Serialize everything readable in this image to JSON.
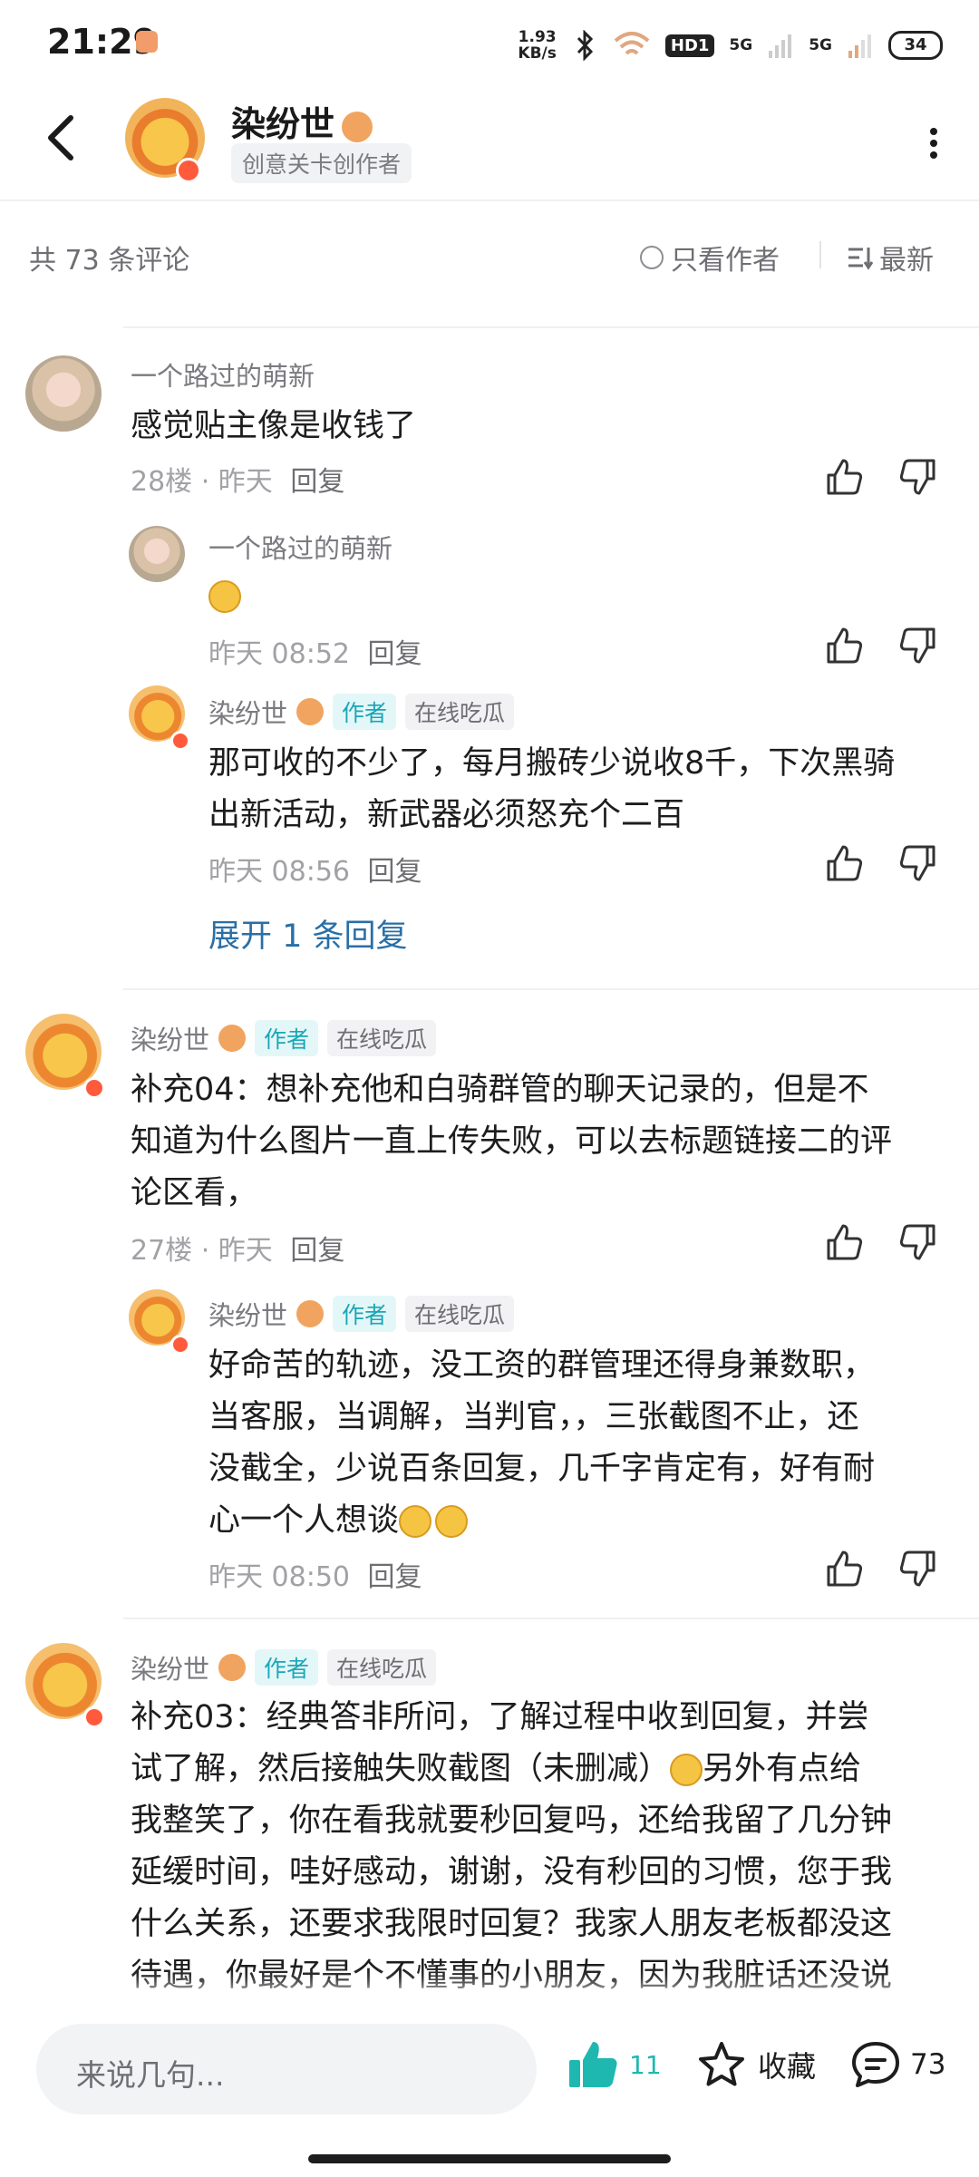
{
  "status_bar": {
    "time": "21:29",
    "net_speed_value": "1.93",
    "net_speed_unit": "KB/s",
    "hd_label": "HD1",
    "signal_1": "5G",
    "signal_2": "5G",
    "battery": "34"
  },
  "header": {
    "author_name": "染纷世",
    "author_tag": "创意关卡创作者"
  },
  "comment_bar": {
    "count_text": "共 73 条评论",
    "only_author_label": "只看作者",
    "sort_label": "最新"
  },
  "comments": [
    {
      "user": "一个路过的萌新",
      "text": "感觉贴主像是收钱了",
      "floor": "28楼",
      "time": "昨天",
      "reply_label": "回复",
      "replies": [
        {
          "user": "一个路过的萌新",
          "time": "昨天 08:52",
          "reply_label": "回复"
        },
        {
          "user": "染纷世",
          "author_tag": "作者",
          "status_tag": "在线吃瓜",
          "text_l1": "那可收的不少了，每月搬砖少说收8千，下次黑骑",
          "text_l2": "出新活动，新武器必须怒充个二百",
          "time": "昨天 08:56",
          "reply_label": "回复"
        }
      ],
      "expand_label": "展开 1 条回复"
    },
    {
      "user": "染纷世",
      "author_tag": "作者",
      "status_tag": "在线吃瓜",
      "text_l1": "补充04：想补充他和白骑群管的聊天记录的，但是不",
      "text_l2": "知道为什么图片一直上传失败，可以去标题链接二的评",
      "text_l3": "论区看，",
      "floor": "27楼",
      "time": "昨天",
      "reply_label": "回复",
      "replies": [
        {
          "user": "染纷世",
          "author_tag": "作者",
          "status_tag": "在线吃瓜",
          "text_l1": "好命苦的轨迹，没工资的群管理还得身兼数职，",
          "text_l2": "当客服，当调解，当判官，，三张截图不止，还",
          "text_l3": "没截全，少说百条回复，几千字肯定有，好有耐",
          "text_l4": "心一个人想谈",
          "time": "昨天 08:50",
          "reply_label": "回复"
        }
      ]
    },
    {
      "user": "染纷世",
      "author_tag": "作者",
      "status_tag": "在线吃瓜",
      "text_l1": "补充03：经典答非所问，了解过程中收到回复，并尝",
      "text_l2a": "试了解，然后接触失败截图（未删减）",
      "text_l2b": "另外有点给",
      "text_l3": "我整笑了，你在看我就要秒回复吗，还给我留了几分钟",
      "text_l4": "延缓时间，哇好感动，谢谢，没有秒回的习惯，您于我",
      "text_l5": "什么关系，还要求我限时回复？我家人朋友老板都没这",
      "text_l6": "待遇，你最好是个不懂事的小朋友，因为我脏话还没说"
    }
  ],
  "bottom_bar": {
    "input_placeholder": "来说几句...",
    "like_count": "11",
    "favorite_label": "收藏",
    "comment_count": "73"
  },
  "colors": {
    "accent_teal": "#1fb8b0",
    "link_blue": "#2a6fa6",
    "author_tag_text": "#1aa6b7"
  }
}
